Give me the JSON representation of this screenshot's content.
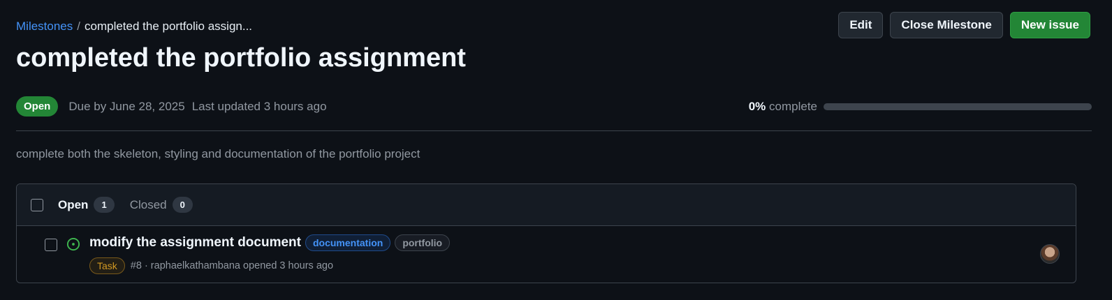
{
  "breadcrumb": {
    "root": "Milestones",
    "separator": "/",
    "current": "completed the portfolio assign..."
  },
  "actions": {
    "edit": "Edit",
    "close": "Close Milestone",
    "new_issue": "New issue"
  },
  "milestone": {
    "title": "completed the portfolio assignment",
    "state": "Open",
    "due": "Due by June 28, 2025",
    "updated": "Last updated 3 hours ago",
    "progress_percent": 0,
    "progress_label": "0%",
    "progress_suffix": "complete",
    "description": "complete both the skeleton, styling and documentation of the portfolio project"
  },
  "issues_header": {
    "open_label": "Open",
    "open_count": "1",
    "closed_label": "Closed",
    "closed_count": "0"
  },
  "issues": [
    {
      "title": "modify the assignment document",
      "labels": [
        "documentation",
        "portfolio"
      ],
      "type": "Task",
      "meta": "#8 · raphaelkathambana opened 3 hours ago",
      "icon": "issue-open-icon",
      "avatar": "user-avatar"
    }
  ],
  "colors": {
    "background": "#0d1117",
    "link": "#4493f8",
    "primary_green": "#238636",
    "muted": "#9198a1",
    "border": "#3d444d"
  }
}
